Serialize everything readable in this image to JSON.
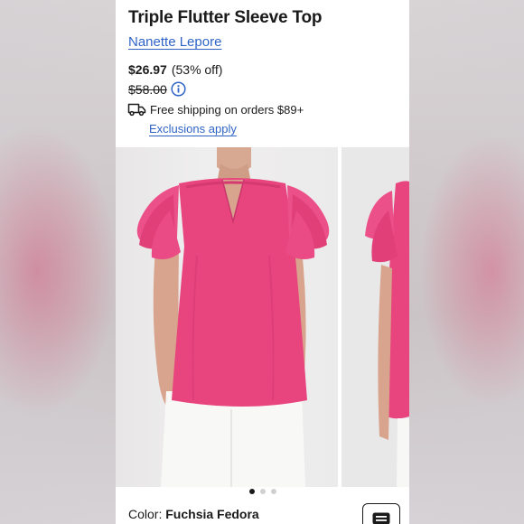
{
  "product": {
    "title": "Triple Flutter Sleeve Top",
    "brand": "Nanette Lepore",
    "price": {
      "sale": "$26.97",
      "discount": "(53% off)",
      "original": "$58.00"
    },
    "shipping": {
      "text": "Free shipping on orders $89+",
      "exclusions_link": "Exclusions apply"
    },
    "gallery": {
      "image_count": 3,
      "active_index": 0
    },
    "color": {
      "label": "Color:",
      "value": "Fuchsia Fedora"
    }
  },
  "theme": {
    "link_color": "#2f64c6",
    "text_color": "#1a1a1a",
    "garment_color": "#e8457f"
  },
  "icons": {
    "info": "info-icon",
    "shipping": "truck-icon",
    "chat": "chat-icon"
  }
}
